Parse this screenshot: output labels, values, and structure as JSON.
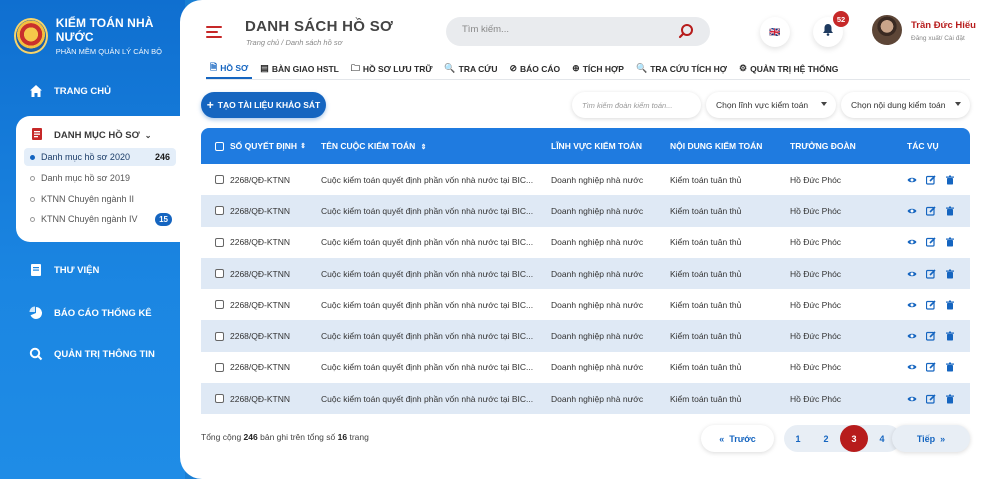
{
  "brand": {
    "title": "KIỂM TOÁN NHÀ NƯỚC",
    "subtitle": "PHẦN MỀM QUẢN LÝ CÁN BỘ"
  },
  "sidebar": {
    "home": "TRANG CHỦ",
    "catalog": "DANH MỤC HỒ SƠ",
    "catalog_items": [
      {
        "label": "Danh mục hồ sơ 2020",
        "count": "246"
      },
      {
        "label": "Danh mục hồ sơ 2019",
        "count": ""
      },
      {
        "label": "KTNN Chuyên ngành II",
        "count": ""
      },
      {
        "label": "KTNN Chuyên ngành IV",
        "count": "15"
      }
    ],
    "library": "THƯ VIỆN",
    "reports": "BÁO CÁO THỐNG KÊ",
    "admin": "QUẢN TRỊ THÔNG TIN"
  },
  "header": {
    "title": "DANH SÁCH HỒ SƠ",
    "breadcrumb": "Trang chủ / Danh sách hồ sơ",
    "search_placeholder": "Tìm kiếm...",
    "language_flag": "🇬🇧",
    "notifications": "52",
    "user_name": "Trần Đức Hiếu",
    "user_links": "Đăng xuất/ Cài đặt"
  },
  "menu": [
    {
      "label": "HỒ SƠ",
      "icon": "🗎"
    },
    {
      "label": "BÀN GIAO HSTL",
      "icon": "▤"
    },
    {
      "label": "HỒ SƠ LƯU TRỮ",
      "icon": "🗀"
    },
    {
      "label": "TRA CỨU",
      "icon": "🔍"
    },
    {
      "label": "BÁO CÁO",
      "icon": "⊘"
    },
    {
      "label": "TÍCH HỢP",
      "icon": "⊕"
    },
    {
      "label": "TRA CỨU TÍCH HỢ",
      "icon": "🔍"
    },
    {
      "label": "QUẢN TRỊ HỆ THỐNG",
      "icon": "⚙"
    }
  ],
  "toolbar": {
    "create_label": "TẠO TÀI LIỆU KHẢO SÁT",
    "filter_team_placeholder": "Tìm kiếm đoàn kiểm toán...",
    "filter_field": "Chọn lĩnh vực kiểm toán",
    "filter_content": "Chọn nội dung kiểm toán"
  },
  "table": {
    "headers": [
      "SỐ QUYẾT ĐỊNH",
      "TÊN CUỘC KIỂM TOÁN",
      "LĨNH VỰC KIỂM TOÁN",
      "NỘI DUNG KIỂM TOÁN",
      "TRƯỞNG ĐOÀN",
      "TÁC VỤ"
    ],
    "rows": [
      [
        "2268/QĐ-KTNN",
        "Cuộc kiểm toán quyết định phần vốn nhà nước tại BIC...",
        "Doanh nghiệp nhà nước",
        "Kiểm toán tuân thủ",
        "Hồ Đức Phóc"
      ],
      [
        "2268/QĐ-KTNN",
        "Cuộc kiểm toán quyết định phần vốn nhà nước tại BIC...",
        "Doanh nghiệp nhà nước",
        "Kiểm toán tuân thủ",
        "Hồ Đức Phóc"
      ],
      [
        "2268/QĐ-KTNN",
        "Cuộc kiểm toán quyết định phần vốn nhà nước tại BIC...",
        "Doanh nghiệp nhà nước",
        "Kiểm toán tuân thủ",
        "Hồ Đức Phóc"
      ],
      [
        "2268/QĐ-KTNN",
        "Cuộc kiểm toán quyết định phần vốn nhà nước tại BIC...",
        "Doanh nghiệp nhà nước",
        "Kiểm toán tuân thủ",
        "Hồ Đức Phóc"
      ],
      [
        "2268/QĐ-KTNN",
        "Cuộc kiểm toán quyết định phần vốn nhà nước tại BIC...",
        "Doanh nghiệp nhà nước",
        "Kiểm toán tuân thủ",
        "Hồ Đức Phóc"
      ],
      [
        "2268/QĐ-KTNN",
        "Cuộc kiểm toán quyết định phần vốn nhà nước tại BIC...",
        "Doanh nghiệp nhà nước",
        "Kiểm toán tuân thủ",
        "Hồ Đức Phóc"
      ],
      [
        "2268/QĐ-KTNN",
        "Cuộc kiểm toán quyết định phần vốn nhà nước tại BIC...",
        "Doanh nghiệp nhà nước",
        "Kiểm toán tuân thủ",
        "Hồ Đức Phóc"
      ],
      [
        "2268/QĐ-KTNN",
        "Cuộc kiểm toán quyết định phần vốn nhà nước tại BIC...",
        "Doanh nghiệp nhà nước",
        "Kiểm toán tuân thủ",
        "Hồ Đức Phóc"
      ]
    ]
  },
  "footer": {
    "total_prefix": "Tổng cộng",
    "total": "246",
    "total_mid": "bản ghi trên tổng số",
    "pages_total": "16",
    "total_suffix": "trang",
    "prev_label": "Trước",
    "next_label": "Tiếp",
    "pages": [
      "1",
      "2",
      "3",
      "4"
    ],
    "current_page": "3"
  },
  "colors": {
    "primary": "#1565c0",
    "accent_red": "#b71c1c",
    "row_alt": "#dfe9f5"
  }
}
